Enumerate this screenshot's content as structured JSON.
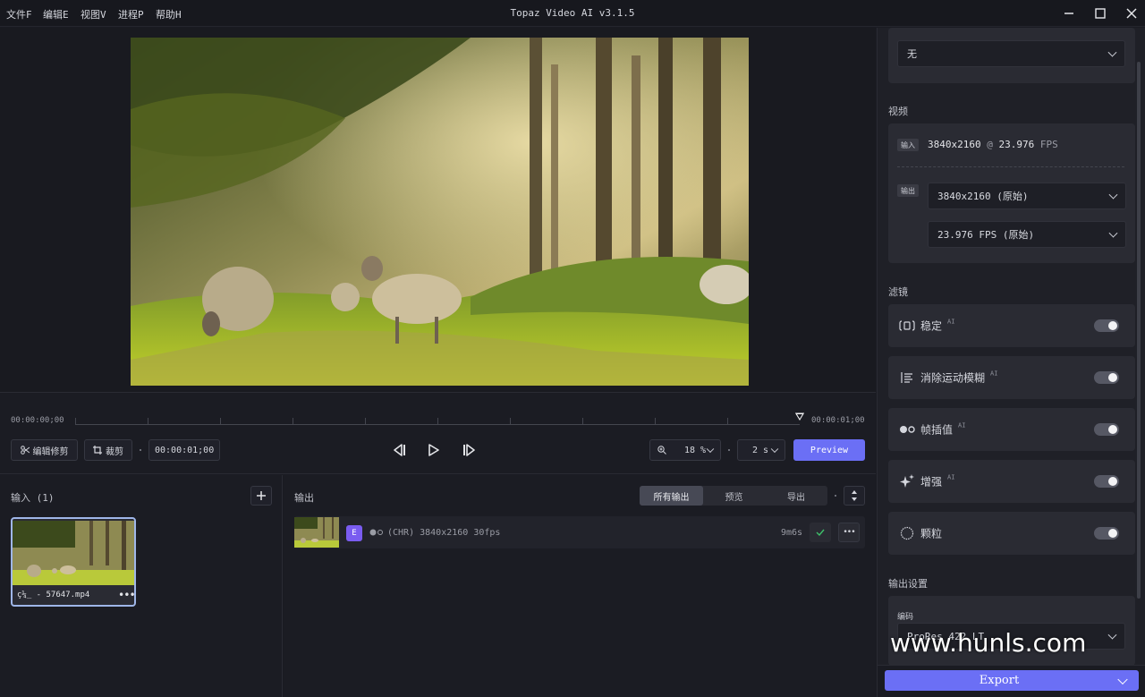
{
  "menu": {
    "file": "文件F",
    "edit": "编辑E",
    "view": "视图V",
    "process": "进程P",
    "help": "帮助H"
  },
  "app_title": "Topaz Video AI  v3.1.5",
  "timeline": {
    "start_time": "00:00:00;00",
    "end_time": "00:00:01;00",
    "edit_trim_label": "编辑修剪",
    "crop_label": "裁剪",
    "duration_value": "00:00:01;00",
    "zoom_value": "18 %",
    "preview_length": "2 s",
    "preview_button": "Preview"
  },
  "input_panel": {
    "title": "输入 (1)",
    "file_name": "ç¼_ - 57647.mp4"
  },
  "output_panel": {
    "title": "输出",
    "tabs": [
      "所有输出",
      "预览",
      "导出"
    ],
    "row": {
      "badge": "E",
      "description": "(CHR) 3840x2160 30fps",
      "duration": "9m6s"
    }
  },
  "right_panel": {
    "top_select_value": "无",
    "video_section_label": "视频",
    "input_tag": "输入",
    "input_resolution": "3840x2160",
    "input_at": "@",
    "input_fps": "23.976",
    "input_fps_unit": "FPS",
    "output_tag": "输出",
    "output_resolution": "3840x2160 (原始)",
    "output_fps": "23.976 FPS (原始)",
    "filters_label": "滤镜",
    "filters": [
      {
        "label": "稳定",
        "ai": "AI",
        "enabled": false
      },
      {
        "label": "消除运动模糊",
        "ai": "AI",
        "enabled": false
      },
      {
        "label": "帧插值",
        "ai": "AI",
        "enabled": false
      },
      {
        "label": "增强",
        "ai": "AI",
        "enabled": false
      },
      {
        "label": "颗粒",
        "ai": "",
        "enabled": false
      }
    ],
    "output_settings_label": "输出设置",
    "codec_label": "编码",
    "codec_value": "ProRes 422 LT",
    "export_button": "Export",
    "watermark": "www.hunls.com"
  },
  "colors": {
    "accent": "#6b6ff5",
    "badge": "#7a5cf0",
    "check": "#3ec06a"
  }
}
